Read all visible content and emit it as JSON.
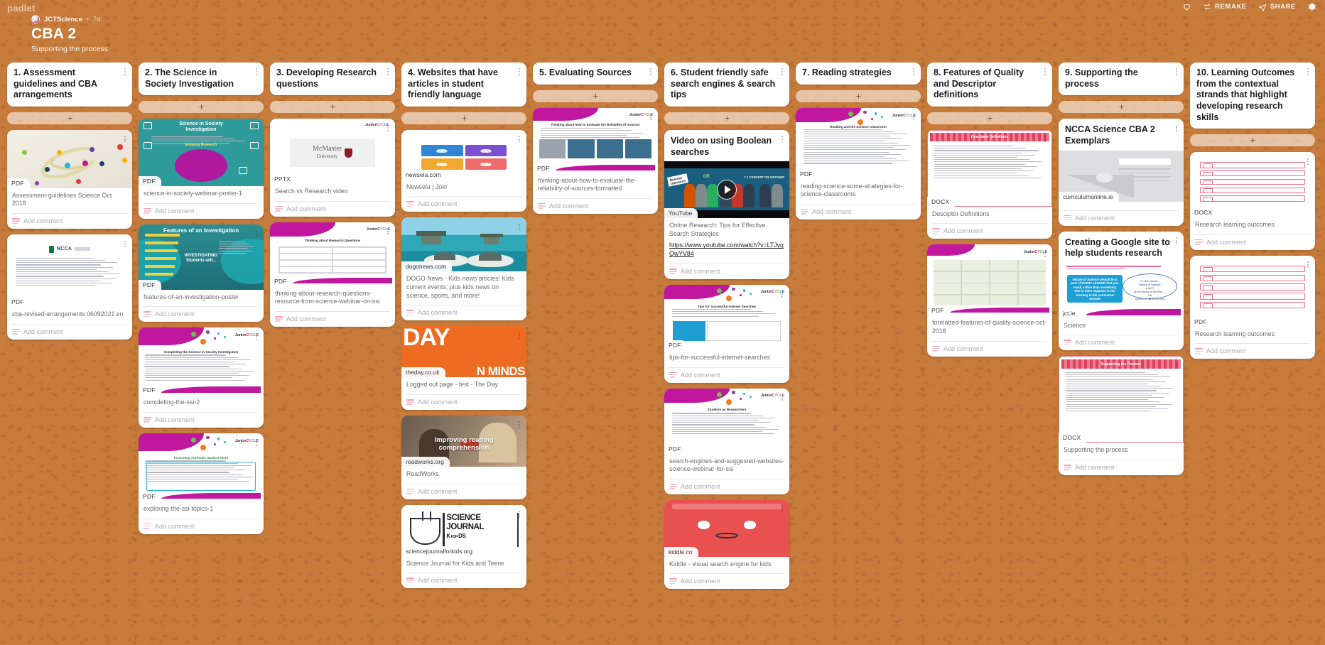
{
  "app": {
    "logo": "padlet"
  },
  "topbar": {
    "favorite_icon": "heart-icon",
    "remake_label": "REMAKE",
    "share_label": "SHARE",
    "settings_icon": "gear-icon"
  },
  "board": {
    "author": "JCTScience",
    "separator": "•",
    "time": "7d",
    "title": "CBA 2",
    "subtitle": "Supporting the process",
    "background_color": "#c87c3c",
    "add_label": "+",
    "comment_placeholder": "Add comment"
  },
  "columns": [
    {
      "title": "1. Assessment guidelines and CBA arrangements",
      "cards": [
        {
          "art": "network",
          "badge": "PDF",
          "caption": "Assessment-guidelines Science Oct 2018",
          "thumb_h": 82
        },
        {
          "art": "ncca",
          "badge": "PDF",
          "caption": "cba-revised-arrangements 06092021 en",
          "thumb_h": 102
        }
      ]
    },
    {
      "title": "2. The Science in Society Investigation",
      "cards": [
        {
          "art": "teal-poster",
          "badge": "PDF",
          "caption": "science-in-society-webinar-poster-1",
          "thumb_h": 95
        },
        {
          "art": "features-poster",
          "badge": "PDF",
          "caption": "features-of-an-investigation-poster",
          "thumb_h": 92
        },
        {
          "art": "jc-text",
          "badge": "PDF",
          "caption": "completing-the-ssi-2",
          "thumb_h": 95
        },
        {
          "art": "jc-boxed",
          "badge": "PDF",
          "caption": "exploring-the-ssi-topics-1",
          "thumb_h": 96
        }
      ]
    },
    {
      "title": "3. Developing Research questions",
      "cards": [
        {
          "art": "mcmaster",
          "badge": "PPTX",
          "caption": "Search vs Research video",
          "thumb_h": 92
        },
        {
          "art": "table-doc",
          "badge": "PDF",
          "caption": "thinking-about-research-questions-resource-from-science-webinar-on-ssi",
          "thumb_h": 90
        }
      ]
    },
    {
      "title": "4. Websites that have articles in student friendly language",
      "cards": [
        {
          "art": "newsela",
          "badge": "newsela.com",
          "badge_type": "site",
          "caption": "Newsela | Join",
          "thumb_h": 70
        },
        {
          "art": "ocean",
          "badge": "dogonews.com",
          "badge_type": "site",
          "caption": "DOGO News - Kids news articles! Kids current events; plus kids news on science, sports, and more!",
          "thumb_h": 76
        },
        {
          "art": "theday",
          "badge": "theday.co.uk",
          "badge_type": "site",
          "caption": "Logged out page - test - The Day",
          "thumb_h": 72
        },
        {
          "art": "readworks",
          "badge": "readworks.org",
          "badge_type": "site",
          "caption": "ReadWorks",
          "thumb_h": 72
        },
        {
          "art": "sciencejournal",
          "badge": "sciencejournalforkids.org",
          "badge_type": "site",
          "caption": "Science Journal for Kids and Teens",
          "thumb_h": 72
        }
      ]
    },
    {
      "title": "5. Evaluating Sources",
      "cards": [
        {
          "art": "evaluate",
          "badge": "PDF",
          "caption": "thinking-about-how-to-evaluate-the-reliability-of-sources-formatted",
          "thumb_h": 92
        }
      ]
    },
    {
      "title": "6. Student friendly safe search engines & search tips",
      "cards": [
        {
          "art": "boolean-video",
          "badge": "YouTube",
          "badge_type": "site",
          "title": "Video on using Boolean searches",
          "caption": "Online Research: Tips for Effective Search Strategies",
          "link": "https://www.youtube.com/watch?v=LTJygQwYV84",
          "thumb_h": 80,
          "play": true
        },
        {
          "art": "jc-tips",
          "badge": "PDF",
          "caption": "tips-for-successful-internet-searches",
          "thumb_h": 92
        },
        {
          "art": "jc-reading",
          "badge": "PDF",
          "caption": "search-engines-and-suggested-websites-science-webinar-for-ssi",
          "thumb_h": 92
        },
        {
          "art": "kiddle",
          "badge": "kiddle.co",
          "badge_type": "site",
          "caption": "Kiddle - visual search engine for kids",
          "thumb_h": 80
        }
      ]
    },
    {
      "title": "7. Reading strategies",
      "cards": [
        {
          "art": "jc-reading2",
          "badge": "PDF",
          "caption": "reading-science-some-strategies-for-science-classrooms",
          "thumb_h": 100
        }
      ]
    },
    {
      "title": "8. Features of Quality and Descriptor definitions",
      "cards": [
        {
          "art": "pinkdoc",
          "badge": "DOCX",
          "badge_label": "Descriptor Definitions",
          "caption": "Desciptor Definitions",
          "thumb_h": 108
        },
        {
          "art": "greentable",
          "badge": "PDF",
          "caption": "formatted-features-of-quality-science-oct-2018",
          "thumb_h": 100
        }
      ]
    },
    {
      "title": "9. Supporting the process",
      "cards": [
        {
          "art": "placeholder",
          "badge": "curriculumonline.ie",
          "badge_type": "site",
          "title": "NCCA Science CBA 2 Exemplars",
          "caption": "",
          "thumb_h": 72
        },
        {
          "art": "gsite",
          "badge": "jct.ie",
          "badge_type": "site",
          "title": "Creating a Google site to help students research",
          "caption": "Science",
          "thumb_h": 78
        },
        {
          "art": "pinkdoc2",
          "badge": "DOCX",
          "caption": "Supporting the process",
          "thumb_h": 122
        }
      ]
    },
    {
      "title": "10. Learning Outcomes from the contextual strands that highlight developing research skills",
      "cards": [
        {
          "art": "redgrid",
          "badge": "DOCX",
          "caption": "Research learning outcomes",
          "thumb_h": 92
        },
        {
          "art": "redgrid",
          "badge": "PDF",
          "caption": "Research learning outcomes",
          "thumb_h": 100
        }
      ]
    }
  ]
}
